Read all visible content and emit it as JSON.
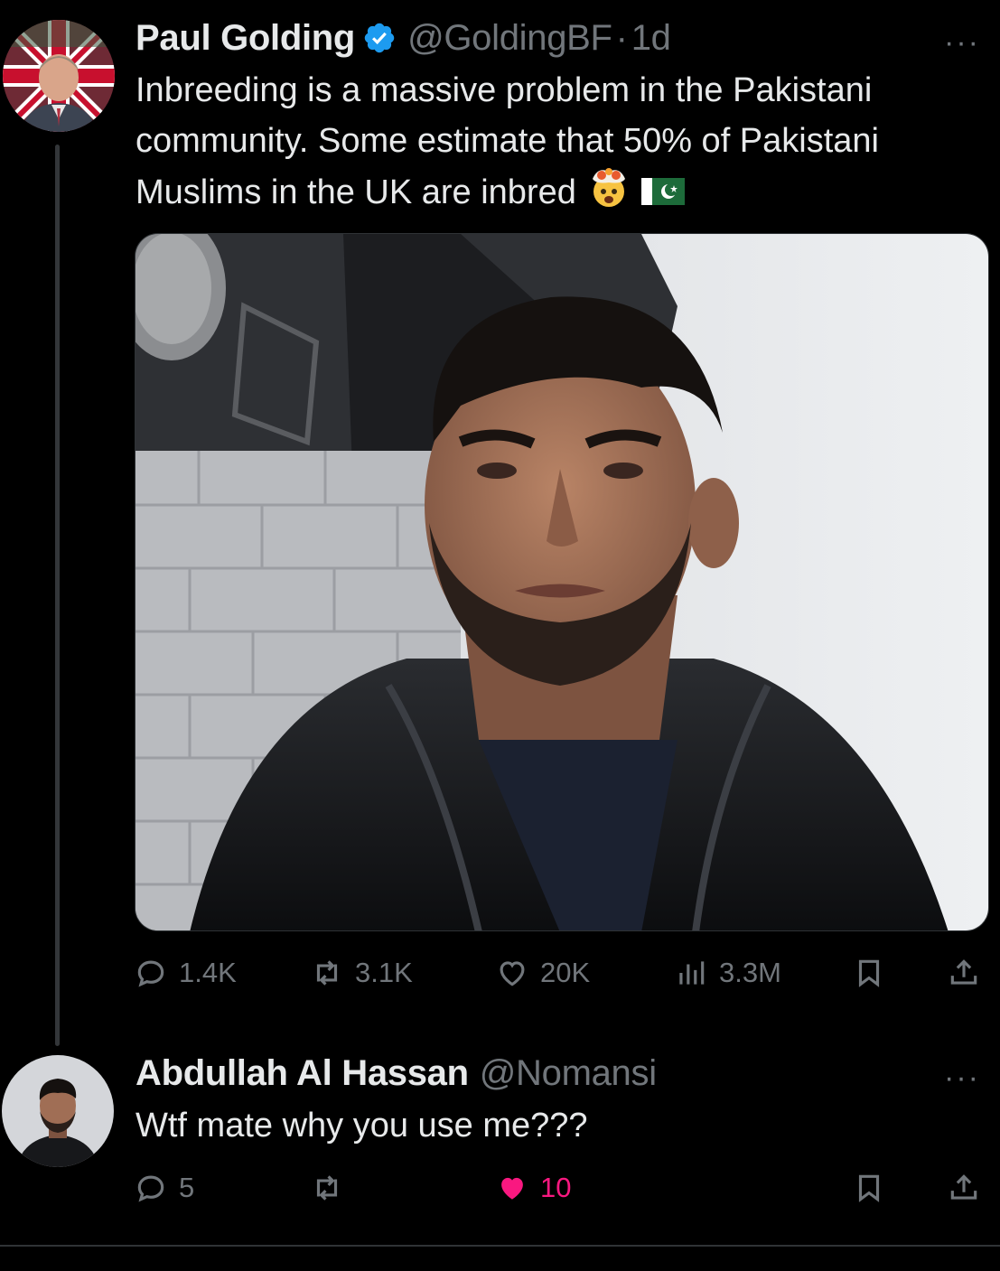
{
  "colors": {
    "background": "#000000",
    "text_primary": "#e7e9ea",
    "text_secondary": "#71767b",
    "verified_blue": "#1d9bf0",
    "like_pink": "#f91880"
  },
  "main_tweet": {
    "author_name": "Paul Golding",
    "handle": "@GoldingBF",
    "separator": "·",
    "time": "1d",
    "verified_icon": "verified-badge-icon",
    "more_label": "···",
    "text": "Inbreeding is a massive problem in the Pakistani community. Some estimate that 50% of Pakistani Muslims in the UK are inbred",
    "emojis": [
      "exploding-head-emoji",
      "pakistan-flag-emoji"
    ],
    "stats": {
      "replies": "1.4K",
      "reposts": "3.1K",
      "likes": "20K",
      "views": "3.3M"
    }
  },
  "reply_tweet": {
    "author_name": "Abdullah Al Hassan",
    "handle": "@Nomansi",
    "more_label": "···",
    "text": "Wtf mate why you use me???",
    "stats": {
      "replies": "5",
      "likes": "10"
    }
  }
}
